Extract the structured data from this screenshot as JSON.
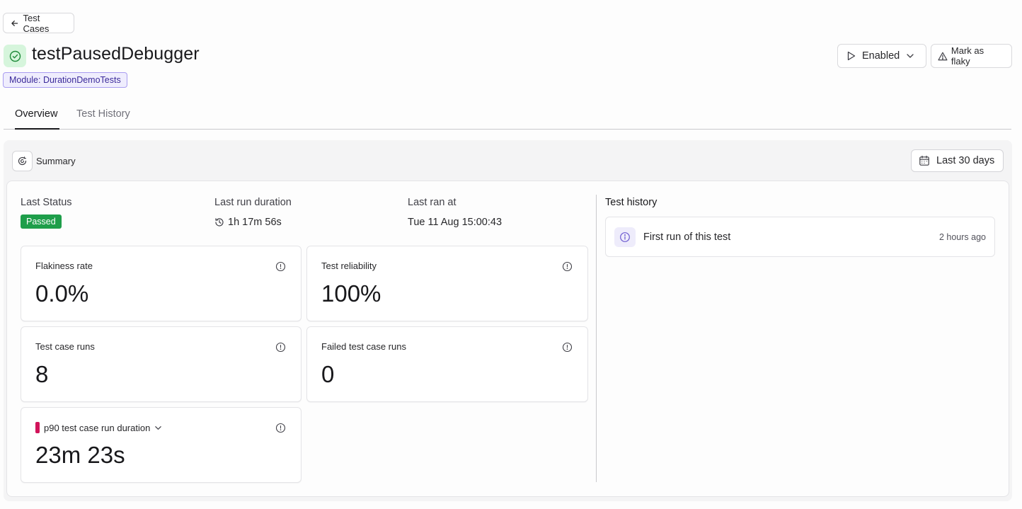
{
  "header": {
    "back_label": "Test Cases",
    "title": "testPausedDebugger",
    "module_badge": "Module: DurationDemoTests",
    "enabled_label": "Enabled",
    "flaky_label": "Mark as flaky"
  },
  "tabs": [
    {
      "label": "Overview",
      "active": true
    },
    {
      "label": "Test History",
      "active": false
    }
  ],
  "summary": {
    "label": "Summary",
    "range_label": "Last 30 days"
  },
  "stats": {
    "last_status_label": "Last Status",
    "last_status_value": "Passed",
    "last_run_duration_label": "Last run duration",
    "last_run_duration_value": "1h 17m 56s",
    "last_ran_at_label": "Last ran at",
    "last_ran_at_value": "Tue 11 Aug 15:00:43"
  },
  "cards": {
    "flakiness": {
      "label": "Flakiness rate",
      "value": "0.0%"
    },
    "reliability": {
      "label": "Test reliability",
      "value": "100%"
    },
    "runs": {
      "label": "Test case runs",
      "value": "8"
    },
    "failed_runs": {
      "label": "Failed test case runs",
      "value": "0"
    },
    "p90": {
      "label": "p90 test case run duration",
      "value": "23m 23s"
    }
  },
  "history": {
    "title": "Test history",
    "items": [
      {
        "text": "First run of this test",
        "time": "2 hours ago"
      }
    ]
  },
  "colors": {
    "passed": "#1e9e4a",
    "status_icon_bg": "#d6f5dc",
    "status_icon": "#1f8a3a",
    "module_badge_border": "#a99df0",
    "p90_accent": "#d1145a",
    "info_icon": "#6d5bd0"
  }
}
